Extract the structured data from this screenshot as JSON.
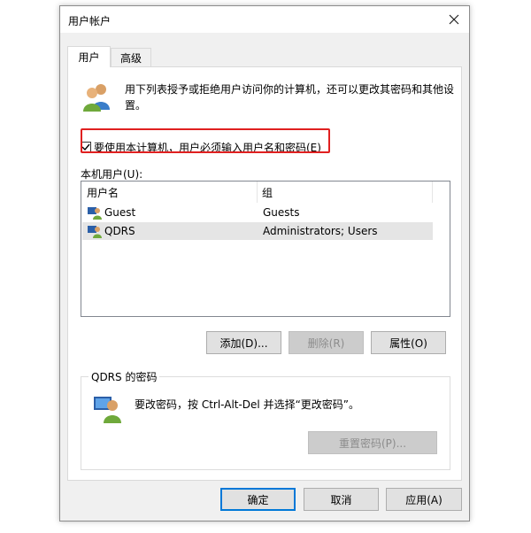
{
  "window": {
    "title": "用户帐户"
  },
  "tabs": [
    {
      "label": "用户"
    },
    {
      "label": "高级"
    }
  ],
  "intro_text": "用下列表授予或拒绝用户访问你的计算机，还可以更改其密码和其他设置。",
  "require_login_checkbox": {
    "label": "要使用本计算机，用户必须输入用户名和密码(E)",
    "checked": true
  },
  "local_users": {
    "label": "本机用户(U):",
    "columns": [
      "用户名",
      "组"
    ],
    "rows": [
      {
        "name": "Guest",
        "group": "Guests",
        "selected": false
      },
      {
        "name": "QDRS",
        "group": "Administrators; Users",
        "selected": true
      }
    ]
  },
  "user_buttons": {
    "add": "添加(D)...",
    "remove": "删除(R)",
    "properties": "属性(O)"
  },
  "password_group": {
    "title": "QDRS 的密码",
    "text": "要改密码，按 Ctrl-Alt-Del 并选择“更改密码”。",
    "reset_button": "重置密码(P)..."
  },
  "footer": {
    "ok": "确定",
    "cancel": "取消",
    "apply": "应用(A)"
  },
  "colors": {
    "highlight": "#e02020",
    "primary_border": "#0078d7"
  }
}
